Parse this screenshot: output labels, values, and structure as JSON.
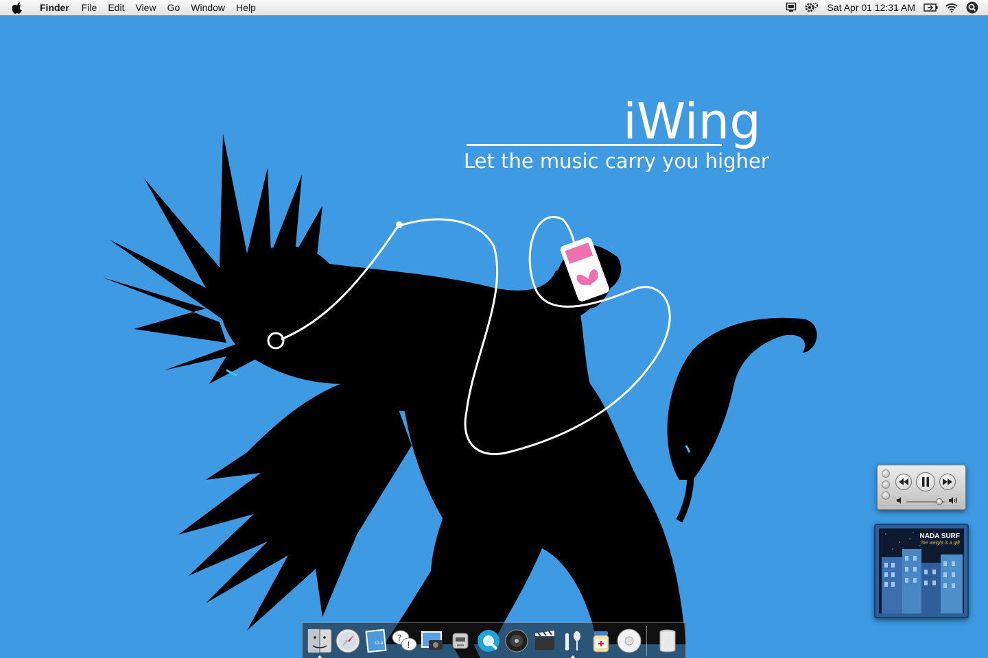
{
  "menubar": {
    "app_name": "Finder",
    "menus": [
      "File",
      "Edit",
      "View",
      "Go",
      "Window",
      "Help"
    ],
    "clock": "Sat Apr 01 12:31 AM",
    "status_icons": [
      "display-icon",
      "gear-icon",
      "battery-icon",
      "wifi-icon",
      "spotlight-icon"
    ]
  },
  "wallpaper": {
    "title": "iWing",
    "tagline": "Let the music carry you higher",
    "background_color": "#3d9ae3"
  },
  "itunes_mini": {
    "state": "playing",
    "volume": 0.85
  },
  "album_widget": {
    "band": "NADA SURF",
    "album": "the weight is a gift"
  },
  "dock": {
    "apps": [
      {
        "name": "finder",
        "running": true
      },
      {
        "name": "safari",
        "running": false
      },
      {
        "name": "mail",
        "running": false
      },
      {
        "name": "ichat",
        "running": false
      },
      {
        "name": "iphoto",
        "running": false
      },
      {
        "name": "automator",
        "running": false
      },
      {
        "name": "quicktime",
        "running": false
      },
      {
        "name": "dvd-player",
        "running": false
      },
      {
        "name": "imovie",
        "running": false
      },
      {
        "name": "itunes",
        "running": true
      },
      {
        "name": "software-update",
        "running": false
      },
      {
        "name": "ipod",
        "running": false
      }
    ],
    "trash": "trash"
  }
}
